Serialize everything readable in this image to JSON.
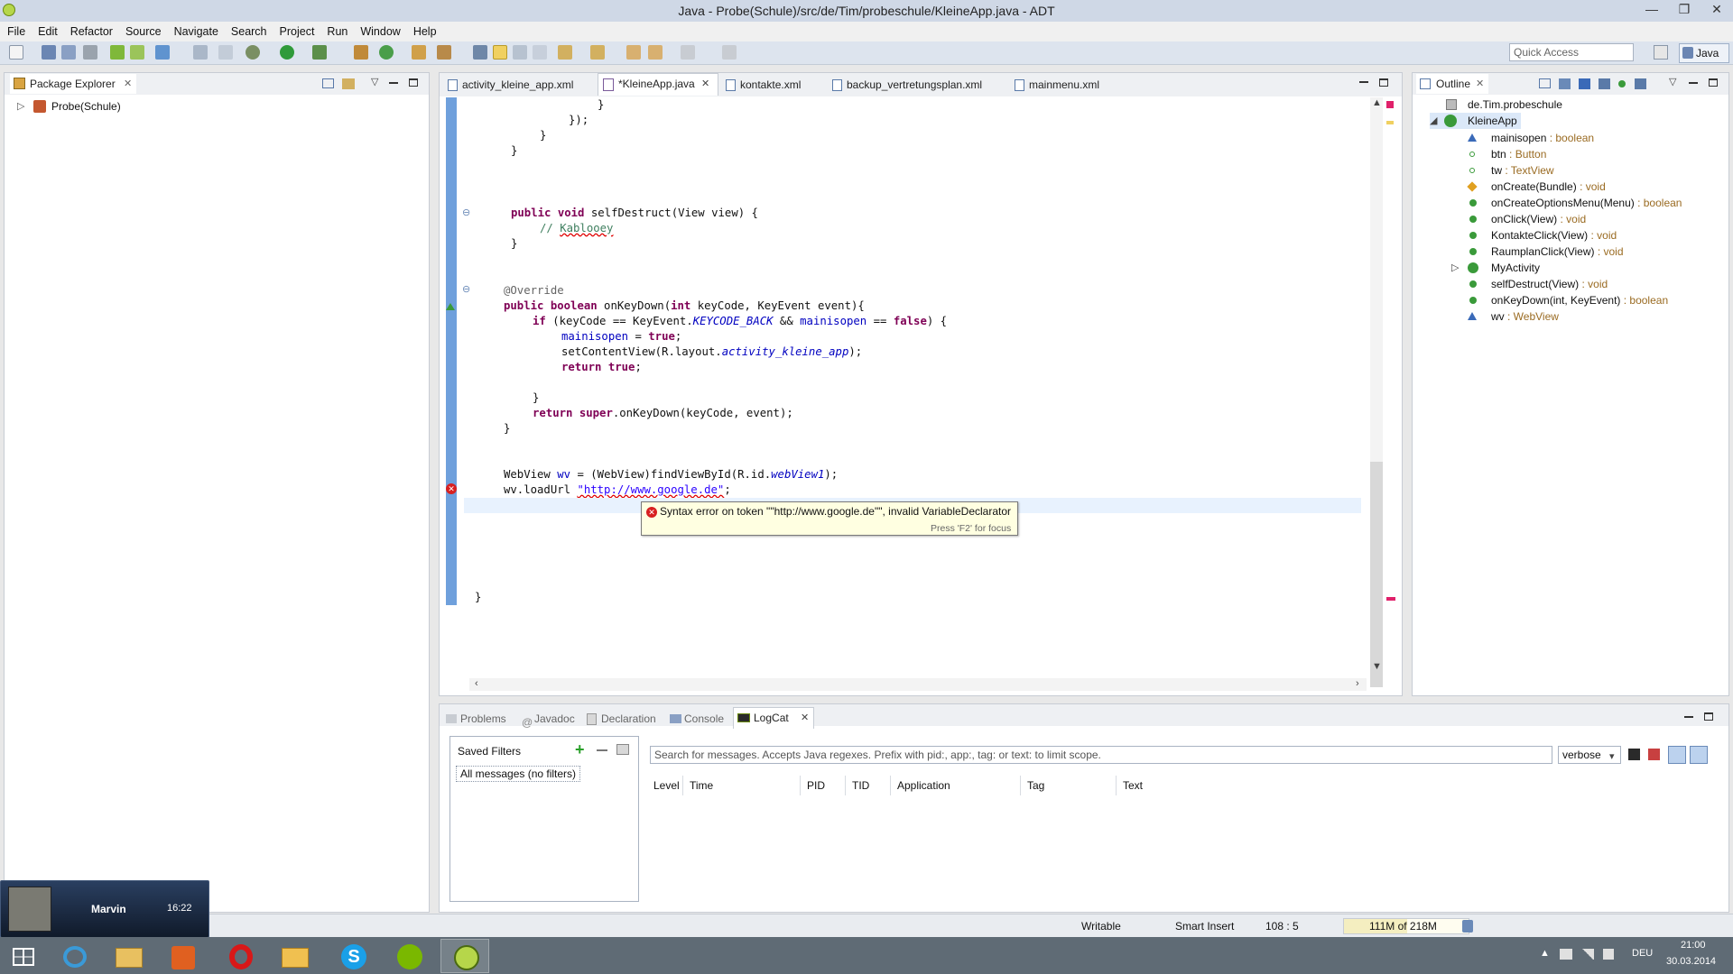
{
  "window": {
    "title": "Java - Probe(Schule)/src/de/Tim/probeschule/KleineApp.java - ADT",
    "controls": [
      "—",
      "❐",
      "✕"
    ]
  },
  "menu": [
    "File",
    "Edit",
    "Refactor",
    "Source",
    "Navigate",
    "Search",
    "Project",
    "Run",
    "Window",
    "Help"
  ],
  "toolbar": {
    "quick_access_placeholder": "Quick Access",
    "perspective_label": "Java"
  },
  "package_explorer": {
    "title": "Package Explorer",
    "project": "Probe(Schule)"
  },
  "editor": {
    "tabs": [
      {
        "label": "activity_kleine_app.xml"
      },
      {
        "label": "*KleineApp.java"
      },
      {
        "label": "kontakte.xml"
      },
      {
        "label": "backup_vertretungsplan.xml"
      },
      {
        "label": "mainmenu.xml"
      }
    ],
    "code": {
      "l1": "}",
      "l2": "});",
      "l3": "}",
      "l4": "}",
      "sd_kw1": "public",
      "sd_kw2": "void",
      "sd_rest": " selfDestruct(View view) {",
      "sd_comment_prefix": "// ",
      "sd_comment_word": "Kablooey",
      "sd_close": "}",
      "override": "@Override",
      "kd_kw1": "public",
      "kd_kw2": "boolean",
      "kd_rest": " onKeyDown(",
      "kd_kw3": "int",
      "kd_rest2": " keyCode, KeyEvent event){",
      "if_kw": "if",
      "if_p1": " (keyCode == KeyEvent.",
      "if_const": "KEYCODE_BACK",
      "if_p2": " && ",
      "if_field": "mainisopen",
      "if_p3": " == ",
      "if_false": "false",
      "if_p4": ") {",
      "assign_field": "mainisopen",
      "assign_op": " = ",
      "assign_true": "true",
      "assign_end": ";",
      "scv_pre": "setContentView(R.layout.",
      "scv_const": "activity_kleine_app",
      "scv_end": ");",
      "ret_kw": "return",
      "ret_true": "true",
      "ret_end": ";",
      "if_close": "}",
      "ret2_kw": "return",
      "ret2_super": "super",
      "ret2_rest": ".onKeyDown(keyCode, event);",
      "kd_close": "}",
      "wv_pre": "WebView ",
      "wv_field": "wv",
      "wv_mid": " = (WebView)findViewById(R.id.",
      "wv_const": "webView1",
      "wv_end": ");",
      "load_pre": "wv.loadUrl ",
      "load_str": "\"http://www.google.de\"",
      "load_end": ";",
      "class_close": "}"
    },
    "tooltip": {
      "message": "Syntax error on token \"\"http://www.google.de\"\", invalid VariableDeclarator",
      "hint": "Press 'F2' for focus"
    }
  },
  "outline": {
    "title": "Outline",
    "package": "de.Tim.probeschule",
    "class": "KleineApp",
    "members": [
      {
        "name": "mainisopen",
        "type": " : boolean",
        "icon": "field-default-icon"
      },
      {
        "name": "btn",
        "type": " : Button",
        "icon": "field-icon"
      },
      {
        "name": "tw",
        "type": " : TextView",
        "icon": "field-icon"
      },
      {
        "name": "onCreate(Bundle)",
        "type": " : void",
        "icon": "method-protected-icon"
      },
      {
        "name": "onCreateOptionsMenu(Menu)",
        "type": " : boolean",
        "icon": "method-public-icon"
      },
      {
        "name": "onClick(View)",
        "type": " : void",
        "icon": "method-public-icon"
      },
      {
        "name": "KontakteClick(View)",
        "type": " : void",
        "icon": "method-public-icon"
      },
      {
        "name": "RaumplanClick(View)",
        "type": " : void",
        "icon": "method-public-icon"
      },
      {
        "name": "MyActivity",
        "type": "",
        "icon": "inner-class-icon"
      },
      {
        "name": "selfDestruct(View)",
        "type": " : void",
        "icon": "method-public-icon"
      },
      {
        "name": "onKeyDown(int, KeyEvent)",
        "type": " : boolean",
        "icon": "method-public-icon"
      },
      {
        "name": "wv",
        "type": " : WebView",
        "icon": "field-default-icon"
      }
    ]
  },
  "bottom_panel": {
    "tabs": [
      "Problems",
      "Javadoc",
      "Declaration",
      "Console",
      "LogCat"
    ],
    "saved_filters_label": "Saved Filters",
    "filter_item": "All messages (no filters)",
    "search_placeholder": "Search for messages. Accepts Java regexes. Prefix with pid:, app:, tag: or text: to limit scope.",
    "level_select": "verbose",
    "columns": [
      "Level",
      "Time",
      "PID",
      "TID",
      "Application",
      "Tag",
      "Text"
    ]
  },
  "status": {
    "writable": "Writable",
    "insert_mode": "Smart Insert",
    "position": "108 : 5",
    "heap": "111M of 218M"
  },
  "notification": {
    "name": "Marvin",
    "time": "16:22"
  },
  "taskbar": {
    "language": "DEU",
    "clock_time": "21:00",
    "clock_date": "30.03.2014"
  }
}
